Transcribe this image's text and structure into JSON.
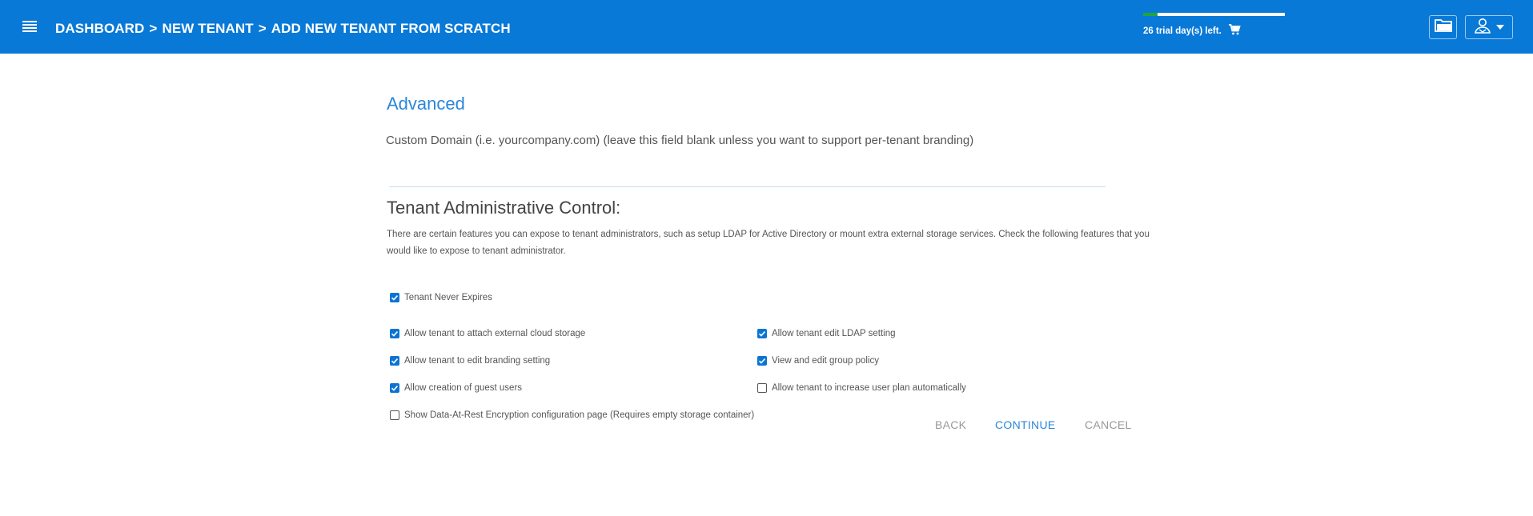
{
  "header": {
    "breadcrumb": [
      "DASHBOARD",
      "NEW TENANT",
      "ADD NEW TENANT FROM SCRATCH"
    ],
    "separator": ">",
    "trial_text": "26 trial day(s) left.",
    "trial_progress": 0.1,
    "icons": [
      "menu-icon",
      "cart-icon",
      "folder-icon",
      "user-icon",
      "caret-down-icon"
    ]
  },
  "advanced": {
    "title": "Advanced",
    "custom_domain_label": "Custom Domain (i.e. yourcompany.com) (leave this field blank unless you want to support per-tenant branding)"
  },
  "control": {
    "title": "Tenant Administrative Control:",
    "description": "There are certain features you can expose to tenant administrators, such as setup LDAP for Active Directory or mount extra external storage services. Check the following features that you would like to expose to tenant administrator.",
    "options": [
      {
        "label": "Tenant Never Expires",
        "checked": true
      },
      {
        "label": "Allow tenant to attach external cloud storage",
        "checked": true
      },
      {
        "label": "Allow tenant edit LDAP setting",
        "checked": true
      },
      {
        "label": "Allow tenant to edit branding setting",
        "checked": true
      },
      {
        "label": "View and edit group policy",
        "checked": true
      },
      {
        "label": "Allow creation of guest users",
        "checked": true
      },
      {
        "label": "Allow tenant to increase user plan automatically",
        "checked": false
      },
      {
        "label": "Show Data-At-Rest Encryption configuration page (Requires empty storage container)",
        "checked": false
      }
    ]
  },
  "actions": {
    "back": "BACK",
    "continue": "CONTINUE",
    "cancel": "CANCEL"
  },
  "colors": {
    "topbar": "#0979d8",
    "accent": "#2a86da",
    "checkbox": "#0a74d3",
    "trial_fill": "#21a53a"
  }
}
